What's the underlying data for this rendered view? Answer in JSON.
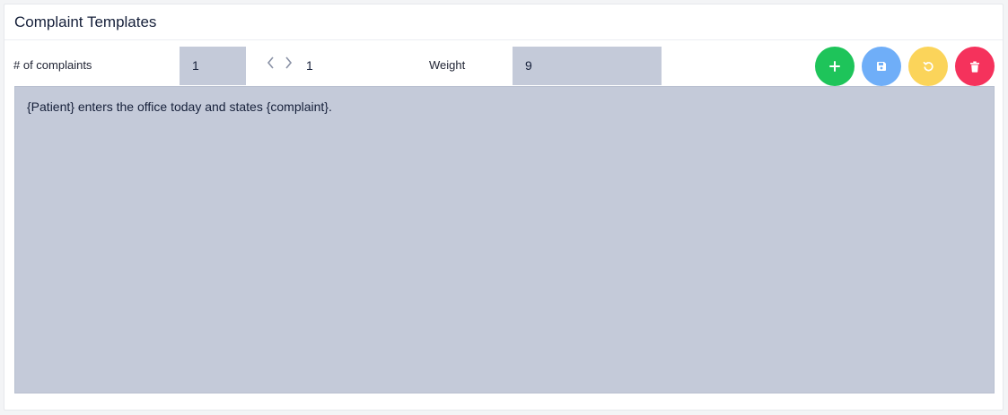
{
  "header": {
    "title": "Complaint Templates"
  },
  "controls": {
    "complaints_label": "# of complaints",
    "complaints_value": "1",
    "current_index": "1",
    "weight_label": "Weight",
    "weight_value": "9"
  },
  "actions": {
    "add_color": "#1ec45a",
    "save_color": "#6faef8",
    "reset_color": "#fbd45a",
    "delete_color": "#f5325c"
  },
  "icons": {
    "prev": "chevron-left-icon",
    "next": "chevron-right-icon",
    "add": "plus-icon",
    "save": "floppy-disk-icon",
    "reset": "undo-icon",
    "delete": "trash-icon"
  },
  "editor": {
    "text": "{Patient} enters the office today and states {complaint}."
  }
}
